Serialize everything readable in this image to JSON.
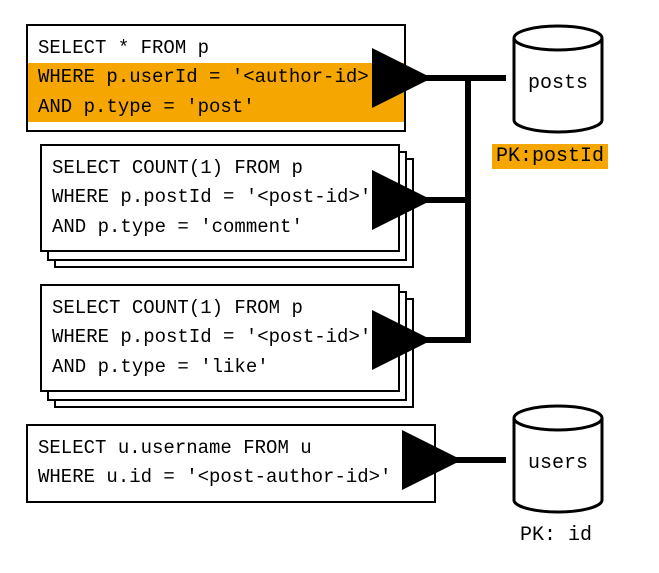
{
  "queries": {
    "q1": {
      "line1": "SELECT * FROM p",
      "line2": "WHERE p.userId = '<author-id>'",
      "line3": "AND p.type = 'post'"
    },
    "q2": {
      "line1": "SELECT COUNT(1) FROM p",
      "line2": "WHERE p.postId = '<post-id>'",
      "line3": "AND p.type = 'comment'"
    },
    "q3": {
      "line1": "SELECT COUNT(1) FROM p",
      "line2": "WHERE p.postId = '<post-id>'",
      "line3": "AND p.type = 'like'"
    },
    "q4": {
      "line1": "SELECT u.username FROM u",
      "line2": "WHERE u.id = '<post-author-id>'"
    }
  },
  "databases": {
    "posts": {
      "label": "posts",
      "pk_prefix": "PK:",
      "pk_field": "postId"
    },
    "users": {
      "label": "users",
      "pk_prefix": "PK:",
      "pk_field": "id"
    }
  }
}
